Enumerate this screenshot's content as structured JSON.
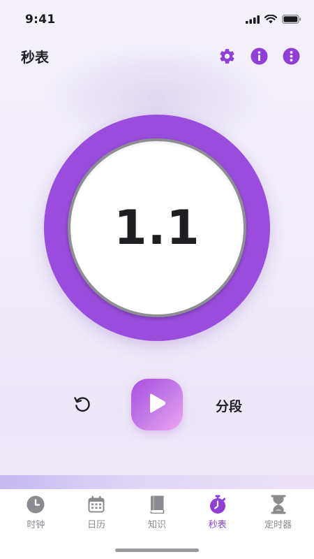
{
  "status_bar": {
    "time": "9:41",
    "signal_icon": "cellular-signal-icon",
    "wifi_icon": "wifi-icon",
    "battery_icon": "battery-icon"
  },
  "header": {
    "title": "秒表",
    "actions": [
      "gear-icon",
      "info-icon",
      "more-vertical-icon"
    ],
    "accent_color": "#8f3fd6"
  },
  "stopwatch": {
    "display": "1.1",
    "ring_color": "#9a4ddd"
  },
  "controls": {
    "reset_icon": "reset-icon",
    "play_icon": "play-icon",
    "lap_label": "分段"
  },
  "tabs": [
    {
      "label": "时钟",
      "icon": "clock-icon",
      "active": false
    },
    {
      "label": "日历",
      "icon": "calendar-icon",
      "active": false
    },
    {
      "label": "知识",
      "icon": "book-icon",
      "active": false
    },
    {
      "label": "秒表",
      "icon": "stopwatch-icon",
      "active": true
    },
    {
      "label": "定时器",
      "icon": "hourglass-icon",
      "active": false
    }
  ]
}
